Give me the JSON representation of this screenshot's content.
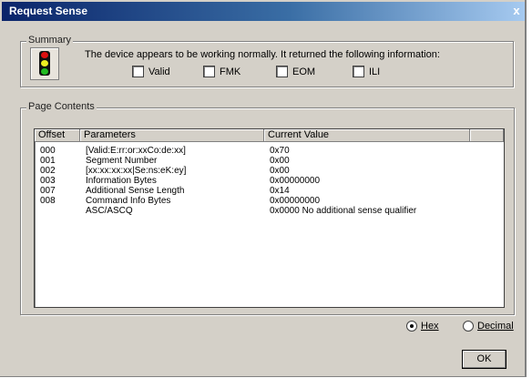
{
  "window": {
    "title": "Request Sense",
    "close_glyph": "x"
  },
  "summary": {
    "legend": "Summary",
    "icon": "traffic-light-icon",
    "message": "The device appears to be working normally. It returned the following information:",
    "flags": [
      {
        "label": "Valid",
        "checked": false
      },
      {
        "label": "FMK",
        "checked": false
      },
      {
        "label": "EOM",
        "checked": false
      },
      {
        "label": "ILI",
        "checked": false
      }
    ]
  },
  "page_contents": {
    "legend": "Page Contents",
    "columns": [
      "Offset",
      "Parameters",
      "Current Value"
    ],
    "rows": [
      {
        "offset": "000",
        "parameter": "[Valid:E:rr:or:xxCo:de:xx]",
        "value": "0x70"
      },
      {
        "offset": "001",
        "parameter": "Segment Number",
        "value": "0x00"
      },
      {
        "offset": "002",
        "parameter": "[xx:xx:xx:xx|Se:ns:eK:ey]",
        "value": "0x00"
      },
      {
        "offset": "003",
        "parameter": "Information Bytes",
        "value": "0x00000000"
      },
      {
        "offset": "007",
        "parameter": "Additional Sense Length",
        "value": "0x14"
      },
      {
        "offset": "008",
        "parameter": "Command Info Bytes",
        "value": "0x00000000"
      },
      {
        "offset": "",
        "parameter": "ASC/ASCQ",
        "value": "0x0000 No additional sense qualifier"
      }
    ]
  },
  "format": {
    "options": [
      {
        "label": "Hex",
        "selected": true
      },
      {
        "label": "Decimal",
        "selected": false
      }
    ]
  },
  "buttons": {
    "ok": "OK"
  }
}
